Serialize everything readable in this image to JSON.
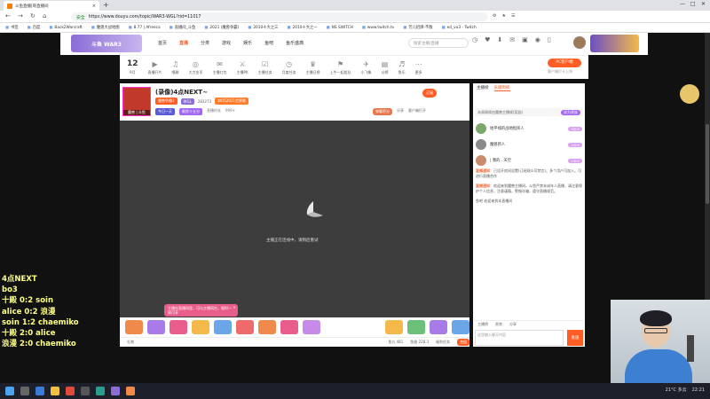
{
  "browser": {
    "tab_title": "斗鱼直播|哥直播间",
    "url_secure": "安全",
    "url": "https://www.douyu.com/topic/WAR3-WGL?rid=11017",
    "bookmarks": [
      "书签",
      "百度",
      "Back2Warcraft",
      "魔兽大战地图",
      "8.77 | Afreeca",
      "直播间_斗鱼",
      "2021 (魔兽争霸)",
      "2010十大之三",
      "2010十大之一",
      "NS SWITCH",
      "www.twitch.tv",
      "芳儿招牌-不散",
      "ed_vo3 - Twitch"
    ]
  },
  "site": {
    "logo_text": "斗鱼 WAR3",
    "nav": [
      "首页",
      "直播",
      "分类",
      "游戏",
      "娱乐",
      "鱼吧",
      "鱼乐盛典"
    ],
    "search_placeholder": "搜索主播/直播"
  },
  "catbar": {
    "date_num": "12",
    "date_label": "9月",
    "items": [
      "直播开片",
      "唱歌",
      "大力金币",
      "主播红包",
      "主播PK",
      "主播任务",
      "月度任务",
      "主播日榜",
      "上午一起组队",
      "小飞象",
      "分榜",
      "鱼乐",
      "更多"
    ],
    "pc_app": "PC客户端",
    "pc_sub": "客户端打卡上线"
  },
  "room": {
    "title": "(录像)4点NEXT~",
    "anchor_name": "魔兽 | 众鱼",
    "tags": [
      "魔兽争霸3",
      "WGL",
      "283273",
      "WOS2021世界赛"
    ],
    "tags2": [
      "今日一天",
      "剩余十五分",
      "直播时长",
      "999+"
    ],
    "follow": "订阅",
    "share_gold": "弹幕积分",
    "share": "分享",
    "client": "客户端打开"
  },
  "video": {
    "message": "主播正在连线中，请稍后重试",
    "notice": "主播在直播间里，可与主播同台，限时一周可享",
    "notice_close": "×"
  },
  "bottom": {
    "items": [
      "礼物",
      "鱼丸 481",
      "鱼翅 228.3",
      "福利任务"
    ],
    "recharge": "充值"
  },
  "chat": {
    "tabs": [
      "主播榜",
      "贡献周榜"
    ],
    "weekly_text": "本周周帧由魔兽主播帧(奖励)",
    "weekly_badge": "成为贵族",
    "ranks": [
      {
        "name": "地平线的战地指挥人",
        "badge": "4000"
      },
      {
        "name": "魔兽新人",
        "badge": "2000"
      },
      {
        "name": "| 我的...天空",
        "badge": "1000"
      }
    ],
    "messages": [
      {
        "sys": "直播通知：",
        "text": "已设开房间设置(订阅观众可禁言)。多个用户可加入。可进行直播合作"
      },
      {
        "sys": "直播通知：",
        "text": "欢迎来到魔兽主播间，斗鱼严禁未成年人直播，请注意保护个人信息，注意谨慎，警惕诈骗，遵守直播规范。"
      },
      {
        "sys": "",
        "text": "鱼吧 欢迎来到本直播间"
      }
    ],
    "fan_rank": [
      "主播榜",
      "贵宾",
      "分享"
    ],
    "input_placeholder": "这里输入聊天内容",
    "send": "发送"
  },
  "overlay_lines": [
    "4点NEXT",
    "bo3",
    "十殿 0:2 soin",
    "alice 0:2 浪漫",
    "soin 1:2 chaemiko",
    "十殿 2:0 alice",
    "浪漫 2:0 chaemiko"
  ],
  "taskbar": {
    "weather": "21°C 多云",
    "time": "22:21"
  }
}
